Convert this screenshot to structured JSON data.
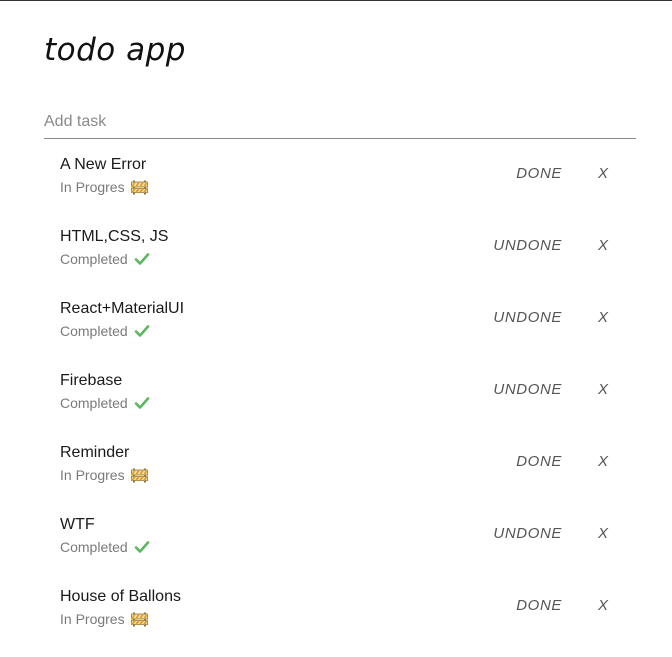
{
  "app": {
    "title": "todo app"
  },
  "add_task": {
    "placeholder": "Add task",
    "value": ""
  },
  "tasks": [
    {
      "name": "A New Error",
      "status": "In Progres",
      "status_icon": "construction-barrier-icon",
      "action": "DONE",
      "delete": "X"
    },
    {
      "name": "HTML,CSS, JS",
      "status": "Completed",
      "status_icon": "check-mark-icon",
      "action": "UNDONE",
      "delete": "X"
    },
    {
      "name": "React+MaterialUI",
      "status": "Completed",
      "status_icon": "check-mark-icon",
      "action": "UNDONE",
      "delete": "X"
    },
    {
      "name": "Firebase",
      "status": "Completed",
      "status_icon": "check-mark-icon",
      "action": "UNDONE",
      "delete": "X"
    },
    {
      "name": "Reminder",
      "status": "In Progres",
      "status_icon": "construction-barrier-icon",
      "action": "DONE",
      "delete": "X"
    },
    {
      "name": "WTF",
      "status": "Completed",
      "status_icon": "check-mark-icon",
      "action": "UNDONE",
      "delete": "X"
    },
    {
      "name": "House of Ballons",
      "status": "In Progres",
      "status_icon": "construction-barrier-icon",
      "action": "DONE",
      "delete": "X"
    }
  ],
  "colors": {
    "check": "#5cb85c",
    "barrier_stripe": "#e0a030",
    "barrier_alt": "#f2e6c8",
    "muted_text": "#7a7a7a"
  }
}
